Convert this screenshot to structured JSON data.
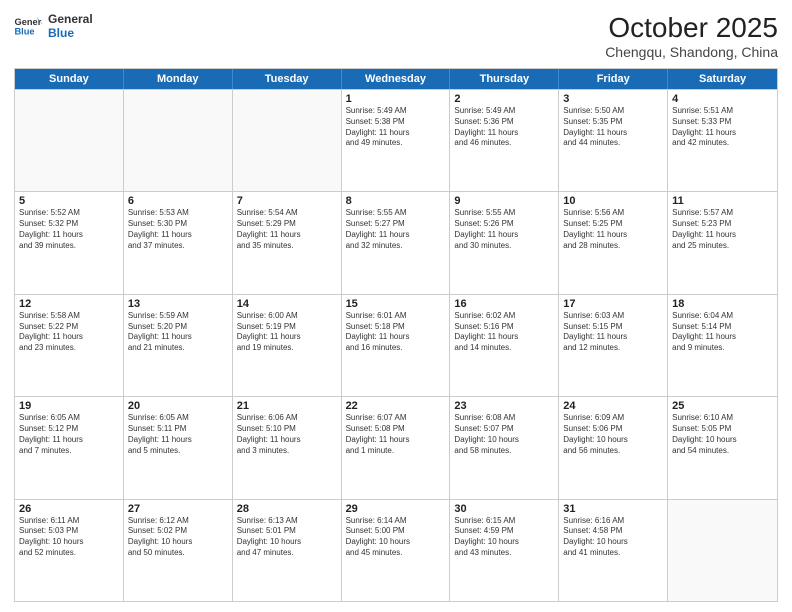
{
  "logo": {
    "line1": "General",
    "line2": "Blue"
  },
  "title": "October 2025",
  "subtitle": "Chengqu, Shandong, China",
  "dow": [
    "Sunday",
    "Monday",
    "Tuesday",
    "Wednesday",
    "Thursday",
    "Friday",
    "Saturday"
  ],
  "weeks": [
    [
      {
        "num": "",
        "info": ""
      },
      {
        "num": "",
        "info": ""
      },
      {
        "num": "",
        "info": ""
      },
      {
        "num": "1",
        "info": "Sunrise: 5:49 AM\nSunset: 5:38 PM\nDaylight: 11 hours\nand 49 minutes."
      },
      {
        "num": "2",
        "info": "Sunrise: 5:49 AM\nSunset: 5:36 PM\nDaylight: 11 hours\nand 46 minutes."
      },
      {
        "num": "3",
        "info": "Sunrise: 5:50 AM\nSunset: 5:35 PM\nDaylight: 11 hours\nand 44 minutes."
      },
      {
        "num": "4",
        "info": "Sunrise: 5:51 AM\nSunset: 5:33 PM\nDaylight: 11 hours\nand 42 minutes."
      }
    ],
    [
      {
        "num": "5",
        "info": "Sunrise: 5:52 AM\nSunset: 5:32 PM\nDaylight: 11 hours\nand 39 minutes."
      },
      {
        "num": "6",
        "info": "Sunrise: 5:53 AM\nSunset: 5:30 PM\nDaylight: 11 hours\nand 37 minutes."
      },
      {
        "num": "7",
        "info": "Sunrise: 5:54 AM\nSunset: 5:29 PM\nDaylight: 11 hours\nand 35 minutes."
      },
      {
        "num": "8",
        "info": "Sunrise: 5:55 AM\nSunset: 5:27 PM\nDaylight: 11 hours\nand 32 minutes."
      },
      {
        "num": "9",
        "info": "Sunrise: 5:55 AM\nSunset: 5:26 PM\nDaylight: 11 hours\nand 30 minutes."
      },
      {
        "num": "10",
        "info": "Sunrise: 5:56 AM\nSunset: 5:25 PM\nDaylight: 11 hours\nand 28 minutes."
      },
      {
        "num": "11",
        "info": "Sunrise: 5:57 AM\nSunset: 5:23 PM\nDaylight: 11 hours\nand 25 minutes."
      }
    ],
    [
      {
        "num": "12",
        "info": "Sunrise: 5:58 AM\nSunset: 5:22 PM\nDaylight: 11 hours\nand 23 minutes."
      },
      {
        "num": "13",
        "info": "Sunrise: 5:59 AM\nSunset: 5:20 PM\nDaylight: 11 hours\nand 21 minutes."
      },
      {
        "num": "14",
        "info": "Sunrise: 6:00 AM\nSunset: 5:19 PM\nDaylight: 11 hours\nand 19 minutes."
      },
      {
        "num": "15",
        "info": "Sunrise: 6:01 AM\nSunset: 5:18 PM\nDaylight: 11 hours\nand 16 minutes."
      },
      {
        "num": "16",
        "info": "Sunrise: 6:02 AM\nSunset: 5:16 PM\nDaylight: 11 hours\nand 14 minutes."
      },
      {
        "num": "17",
        "info": "Sunrise: 6:03 AM\nSunset: 5:15 PM\nDaylight: 11 hours\nand 12 minutes."
      },
      {
        "num": "18",
        "info": "Sunrise: 6:04 AM\nSunset: 5:14 PM\nDaylight: 11 hours\nand 9 minutes."
      }
    ],
    [
      {
        "num": "19",
        "info": "Sunrise: 6:05 AM\nSunset: 5:12 PM\nDaylight: 11 hours\nand 7 minutes."
      },
      {
        "num": "20",
        "info": "Sunrise: 6:05 AM\nSunset: 5:11 PM\nDaylight: 11 hours\nand 5 minutes."
      },
      {
        "num": "21",
        "info": "Sunrise: 6:06 AM\nSunset: 5:10 PM\nDaylight: 11 hours\nand 3 minutes."
      },
      {
        "num": "22",
        "info": "Sunrise: 6:07 AM\nSunset: 5:08 PM\nDaylight: 11 hours\nand 1 minute."
      },
      {
        "num": "23",
        "info": "Sunrise: 6:08 AM\nSunset: 5:07 PM\nDaylight: 10 hours\nand 58 minutes."
      },
      {
        "num": "24",
        "info": "Sunrise: 6:09 AM\nSunset: 5:06 PM\nDaylight: 10 hours\nand 56 minutes."
      },
      {
        "num": "25",
        "info": "Sunrise: 6:10 AM\nSunset: 5:05 PM\nDaylight: 10 hours\nand 54 minutes."
      }
    ],
    [
      {
        "num": "26",
        "info": "Sunrise: 6:11 AM\nSunset: 5:03 PM\nDaylight: 10 hours\nand 52 minutes."
      },
      {
        "num": "27",
        "info": "Sunrise: 6:12 AM\nSunset: 5:02 PM\nDaylight: 10 hours\nand 50 minutes."
      },
      {
        "num": "28",
        "info": "Sunrise: 6:13 AM\nSunset: 5:01 PM\nDaylight: 10 hours\nand 47 minutes."
      },
      {
        "num": "29",
        "info": "Sunrise: 6:14 AM\nSunset: 5:00 PM\nDaylight: 10 hours\nand 45 minutes."
      },
      {
        "num": "30",
        "info": "Sunrise: 6:15 AM\nSunset: 4:59 PM\nDaylight: 10 hours\nand 43 minutes."
      },
      {
        "num": "31",
        "info": "Sunrise: 6:16 AM\nSunset: 4:58 PM\nDaylight: 10 hours\nand 41 minutes."
      },
      {
        "num": "",
        "info": ""
      }
    ]
  ]
}
